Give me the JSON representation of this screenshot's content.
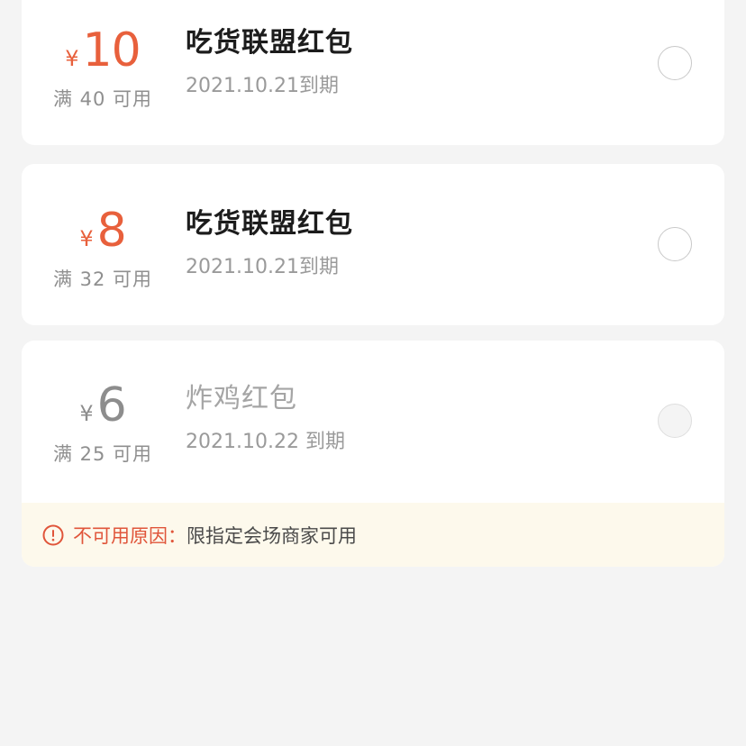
{
  "coupons": [
    {
      "currency": "¥",
      "amount": "10",
      "threshold": "满 40 可用",
      "title": "吃货联盟红包",
      "expire": "2021.10.21到期",
      "available": true
    },
    {
      "currency": "¥",
      "amount": "8",
      "threshold": "满 32 可用",
      "title": "吃货联盟红包",
      "expire": "2021.10.21到期",
      "available": true
    },
    {
      "currency": "¥",
      "amount": "6",
      "threshold": "满 25 可用",
      "title": "炸鸡红包",
      "expire": "2021.10.22 到期",
      "available": false,
      "reason_label": "不可用原因：",
      "reason_text": "限指定会场商家可用"
    }
  ],
  "colors": {
    "accent": "#e8603c",
    "disabled_amount": "#8d8d8d",
    "warning_bg": "#fdf9ec",
    "page_bg": "#f4f4f4"
  },
  "icons": {
    "warning": "exclamation-circle-icon"
  }
}
